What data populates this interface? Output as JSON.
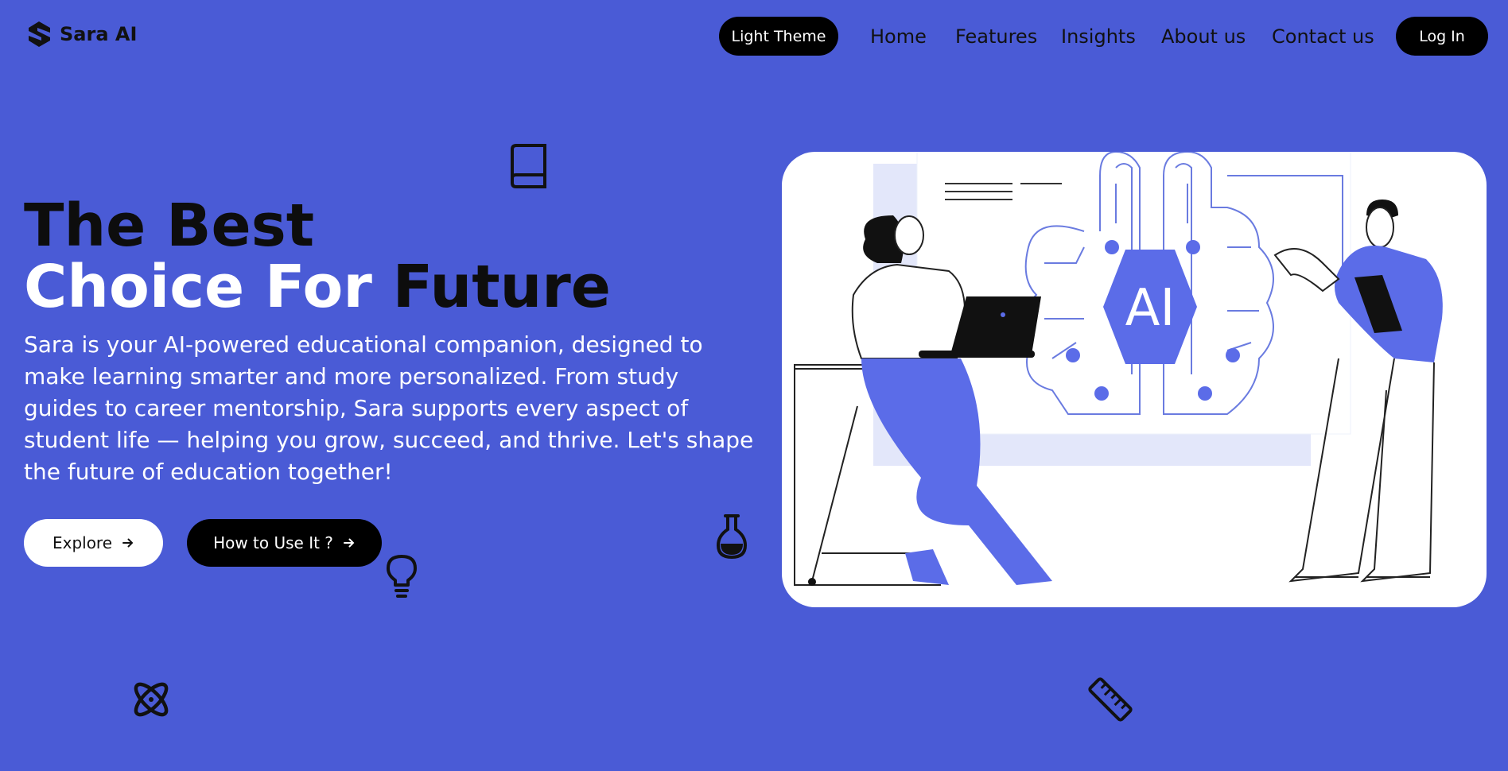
{
  "nav": {
    "brand": "Sara AI",
    "theme_toggle": "Light Theme",
    "links": [
      "Home",
      "Features",
      "Insights",
      "About us",
      "Contact us"
    ],
    "login": "Log In"
  },
  "hero": {
    "title_line1": "The Best",
    "title_line2_white": "Choice For",
    "title_line2_dark": "Future",
    "description": "Sara is your AI-powered educational companion, designed to make learning smarter and more personalized. From study guides to career mentorship, Sara supports every aspect of student life — helping you grow, succeed, and thrive. Let's shape the future of education together!",
    "explore_label": "Explore",
    "howto_label": "How to Use It ?"
  },
  "illustration": {
    "ai_text": "AI"
  },
  "colors": {
    "background": "#4a5bd6",
    "accent": "#5b6ce8",
    "dark": "#000000",
    "white": "#ffffff"
  },
  "icons": [
    "logo-icon",
    "book-icon",
    "flask-icon",
    "lightbulb-icon",
    "atom-icon",
    "ruler-icon",
    "arrow-right-icon"
  ]
}
